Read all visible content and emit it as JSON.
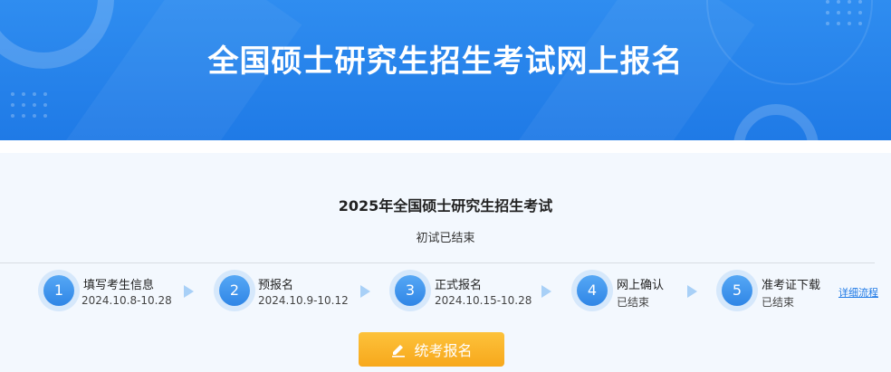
{
  "banner": {
    "title": "全国硕士研究生招生考试网上报名"
  },
  "exam": {
    "title": "2025年全国硕士研究生招生考试",
    "status": "初试已结束"
  },
  "steps": [
    {
      "num": "1",
      "name": "填写考生信息",
      "date": "2024.10.8-10.28"
    },
    {
      "num": "2",
      "name": "预报名",
      "date": "2024.10.9-10.12"
    },
    {
      "num": "3",
      "name": "正式报名",
      "date": "2024.10.15-10.28"
    },
    {
      "num": "4",
      "name": "网上确认",
      "date": "已结束"
    },
    {
      "num": "5",
      "name": "准考证下载",
      "date": "已结束"
    }
  ],
  "detail_link": "详细流程",
  "register_button": {
    "label": "统考报名",
    "icon": "pencil-icon"
  },
  "colors": {
    "banner_blue": "#1f7ae6",
    "step_blue": "#3a90ea",
    "button_orange": "#f7a81c"
  }
}
